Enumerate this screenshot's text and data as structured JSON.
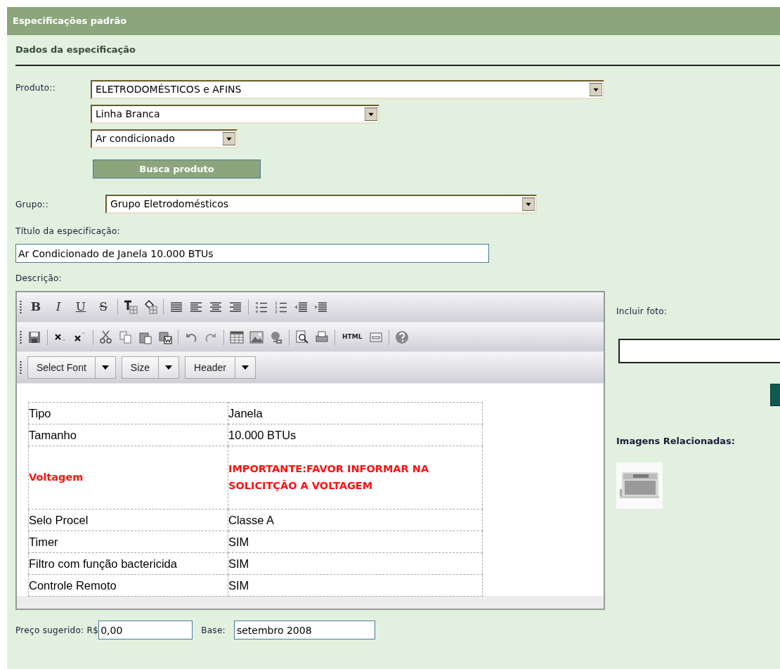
{
  "header": {
    "title": "Especificações padrão"
  },
  "section": {
    "title": "Dados da especificação"
  },
  "product": {
    "label": "Produto::",
    "selects": [
      {
        "value": "ELETRODOMÉSTICOS e AFINS"
      },
      {
        "value": "Linha Branca"
      },
      {
        "value": "Ar condicionado"
      }
    ],
    "search_button": "Busca produto"
  },
  "group": {
    "label": "Grupo::",
    "value": "Grupo Eletrodomésticos"
  },
  "title_field": {
    "label": "Título da especificação:",
    "value": "Ar Condicionado de Janela 10.000 BTUs"
  },
  "description": {
    "label": "Descrição:",
    "editor": {
      "format_glyphs": [
        "B",
        "I",
        "U",
        "S"
      ],
      "html_label": "HTML",
      "dropdowns": [
        "Select Font",
        "Size",
        "Header"
      ],
      "table": [
        {
          "name": "Tipo",
          "value": "Janela",
          "highlight": false
        },
        {
          "name": "Tamanho",
          "value": "10.000 BTUs",
          "highlight": false
        },
        {
          "name": "Voltagem",
          "value": "IMPORTANTE:FAVOR INFORMAR NA SOLICITÇÃO A VOLTAGEM",
          "highlight": true
        },
        {
          "name": "Selo Procel",
          "value": "Classe A",
          "highlight": false
        },
        {
          "name": "Timer",
          "value": "SIM",
          "highlight": false
        },
        {
          "name": "Filtro com função bactericida",
          "value": "SIM",
          "highlight": false
        },
        {
          "name": "Controle Remoto",
          "value": "SIM",
          "highlight": false
        }
      ]
    }
  },
  "price": {
    "label": "Preço sugerido: R$",
    "value": "0,00",
    "base_label": "Base:",
    "base_value": "setembro 2008"
  },
  "photo": {
    "label": "Incluir foto:",
    "related_label": "Imagens Relacionadas:"
  }
}
